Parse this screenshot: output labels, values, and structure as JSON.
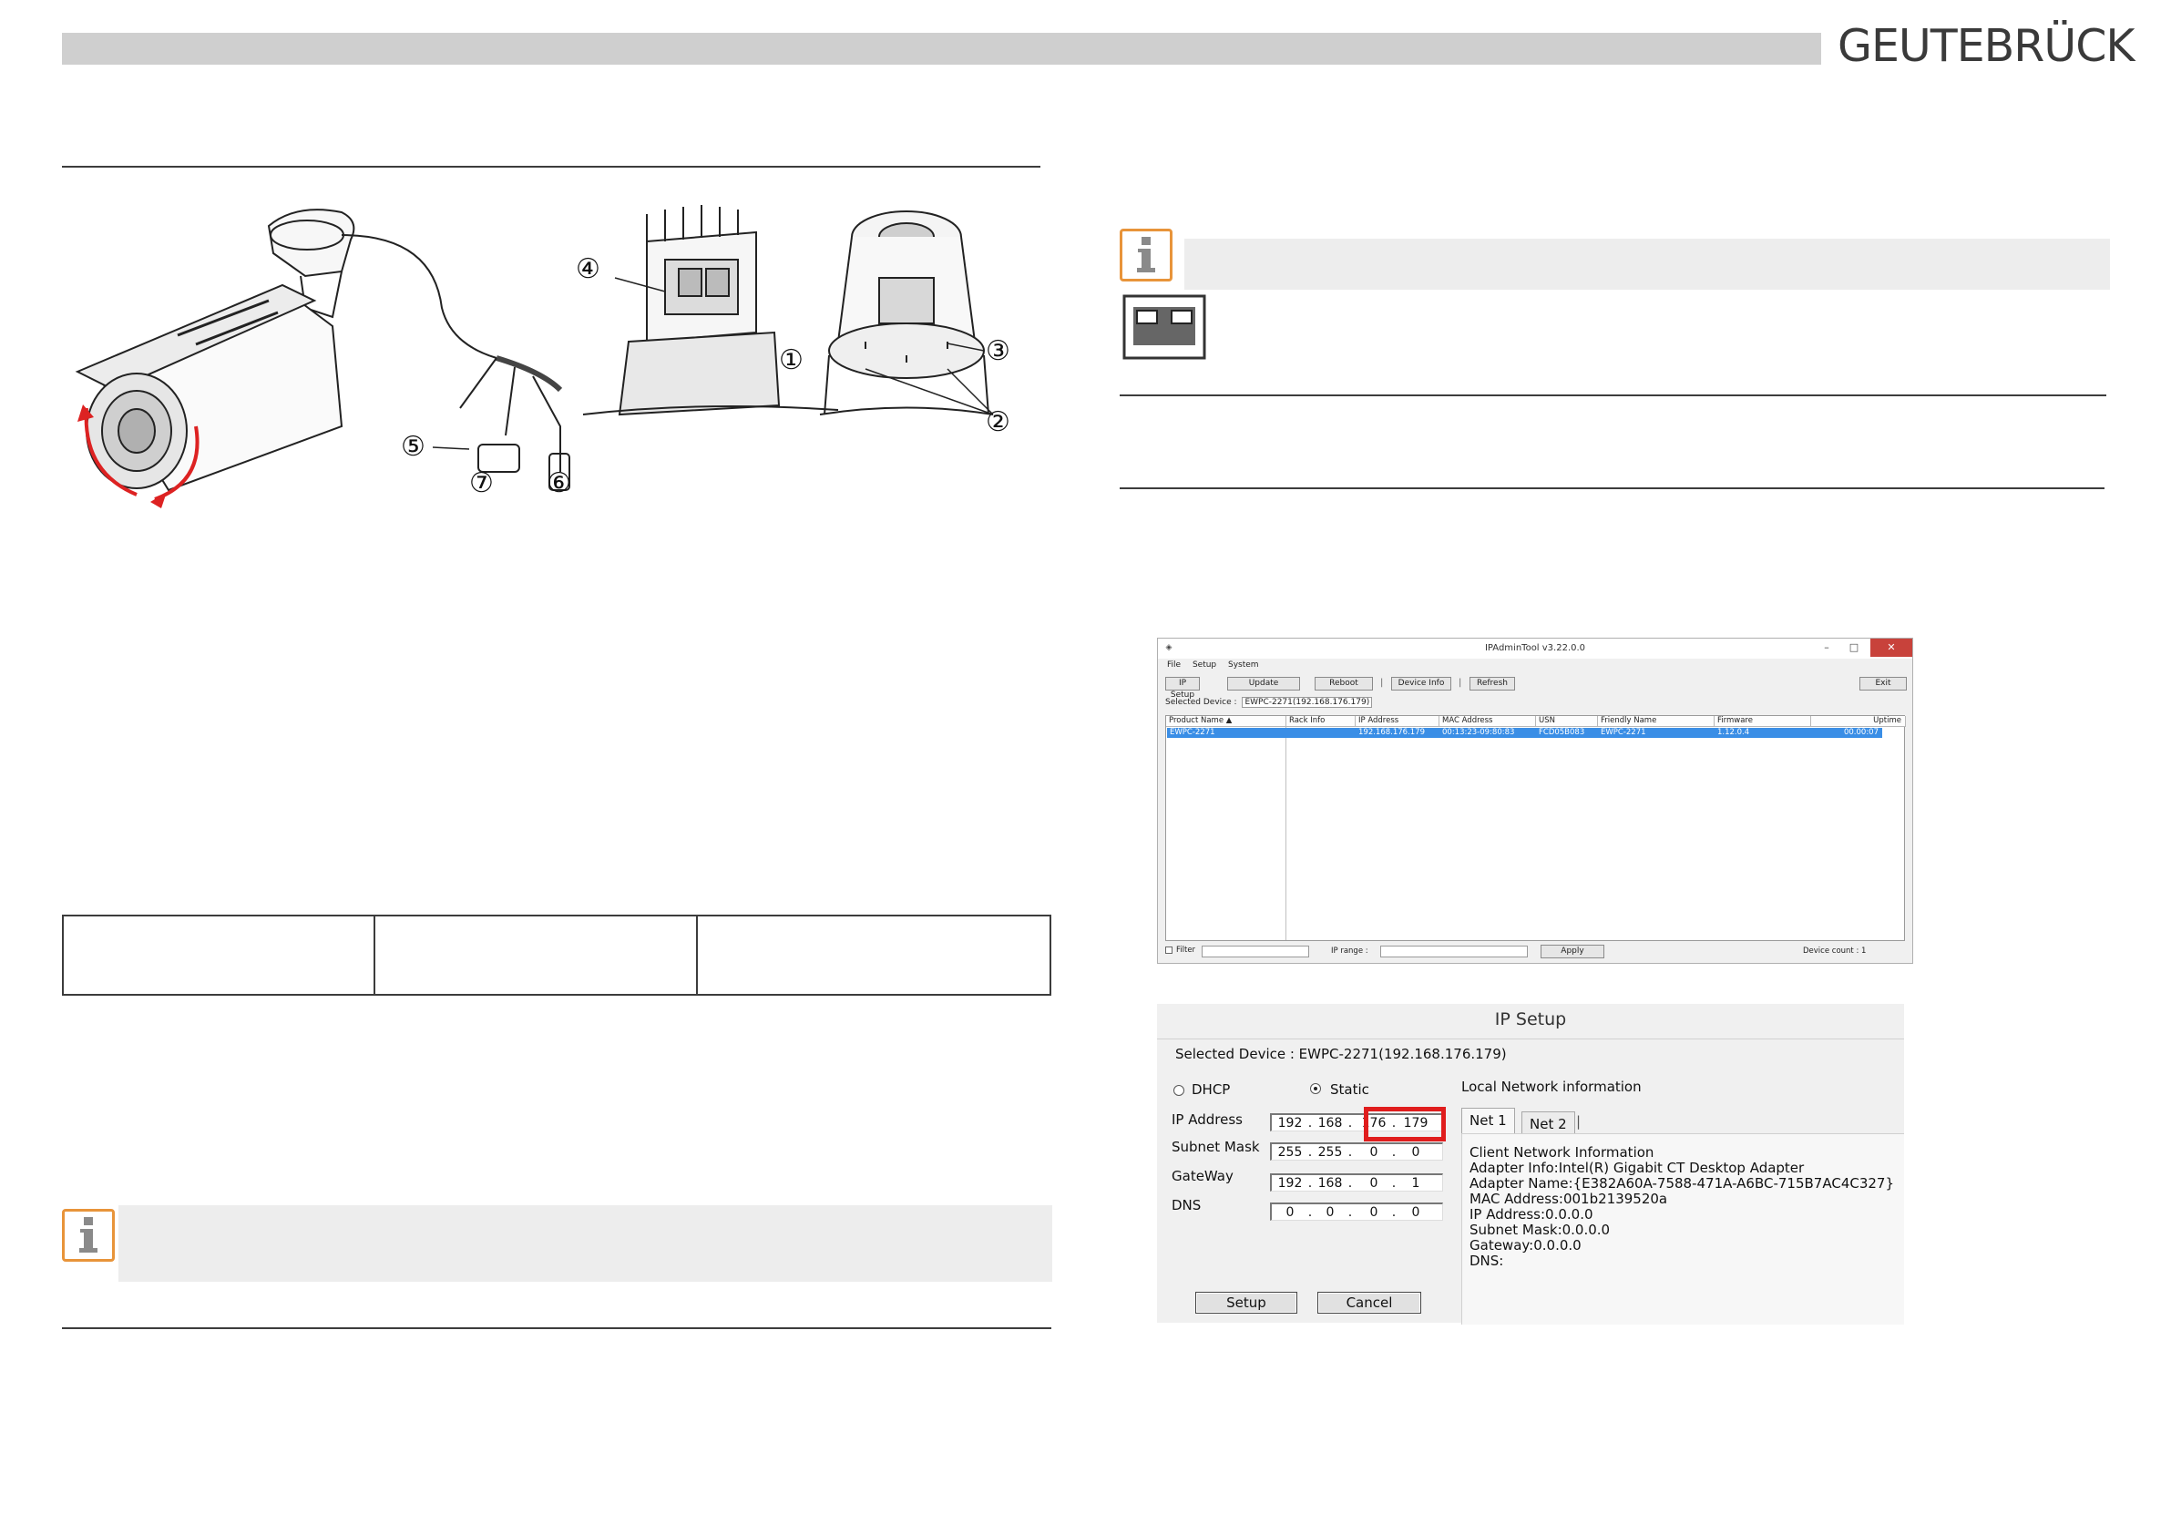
{
  "header": {
    "brand": "GEUTEBRÜCK"
  },
  "camera_callouts": [
    "①",
    "②",
    "②",
    "③",
    "④",
    "⑤",
    "⑥",
    "⑦"
  ],
  "icons": {
    "info": "info-icon",
    "network_port": "ethernet-port-icon"
  },
  "ipadmintool": {
    "title": "IPAdminTool v3.22.0.0",
    "window_buttons": [
      "–",
      "□",
      "✕"
    ],
    "menu": [
      "File",
      "Setup",
      "System"
    ],
    "toolbar": [
      "IP Setup",
      "Update",
      "Reboot",
      "Device Info",
      "Refresh",
      "Exit"
    ],
    "toolbar_separators": [
      "|",
      "|"
    ],
    "selected_label": "Selected Device :",
    "selected_value": "EWPC-2271(192.168.176.179)",
    "columns": [
      "Product Name  ▲",
      "Rack Info",
      "IP Address",
      "MAC Address",
      "USN",
      "Friendly Name",
      "Firmware",
      "Uptime"
    ],
    "row": [
      "EWPC-2271",
      "",
      "192.168.176.179",
      "00:13:23-09:80:83",
      "FCD05B083",
      "EWPC-2271",
      "1.12.0.4",
      "00.00:07"
    ],
    "footer": {
      "filter": "Filter",
      "ip_range": "IP range :",
      "apply": "Apply",
      "device_count": "Device count : 1"
    }
  },
  "ipsetup": {
    "title": "IP Setup",
    "selected_device": "Selected Device :  EWPC-2271(192.168.176.179)",
    "dhcp": "DHCP",
    "static": "Static",
    "local_network": "Local Network information",
    "fields": [
      {
        "label": "IP Address",
        "octets": [
          "192",
          "168",
          "176",
          "179"
        ]
      },
      {
        "label": "Subnet Mask",
        "octets": [
          "255",
          "255",
          "0",
          "0"
        ]
      },
      {
        "label": "GateWay",
        "octets": [
          "192",
          "168",
          "0",
          "1"
        ]
      },
      {
        "label": "DNS",
        "octets": [
          "0",
          "0",
          "0",
          "0"
        ]
      }
    ],
    "octet_separator": ".",
    "tabs": [
      "Net 1",
      "Net 2"
    ],
    "tab_separator": "|",
    "net_info": [
      "Client Network Information",
      "Adapter Info:Intel(R) Gigabit CT Desktop Adapter",
      "Adapter Name:{E382A60A-7588-471A-A6BC-715B7AC4C327}",
      "MAC Address:001b2139520a",
      "IP Address:0.0.0.0",
      "Subnet Mask:0.0.0.0",
      "Gateway:0.0.0.0",
      "DNS:"
    ],
    "setup_button": "Setup",
    "cancel_button": "Cancel"
  }
}
